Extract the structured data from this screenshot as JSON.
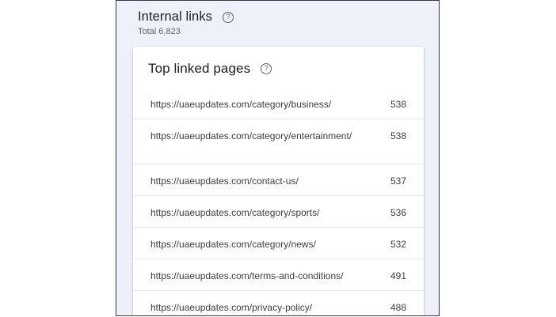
{
  "section": {
    "title": "Internal links",
    "subtitle": "Total 6,823"
  },
  "card": {
    "title": "Top linked pages"
  },
  "rows": [
    {
      "url": "https://uaeupdates.com/category/business/",
      "count": "538"
    },
    {
      "url": "https://uaeupdates.com/category/entertainment/",
      "count": "538"
    },
    {
      "url": "https://uaeupdates.com/contact-us/",
      "count": "537"
    },
    {
      "url": "https://uaeupdates.com/category/sports/",
      "count": "536"
    },
    {
      "url": "https://uaeupdates.com/category/news/",
      "count": "532"
    },
    {
      "url": "https://uaeupdates.com/terms-and-conditions/",
      "count": "491"
    },
    {
      "url": "https://uaeupdates.com/privacy-policy/",
      "count": "488"
    }
  ],
  "icons": {
    "help": "help-circle-icon"
  }
}
